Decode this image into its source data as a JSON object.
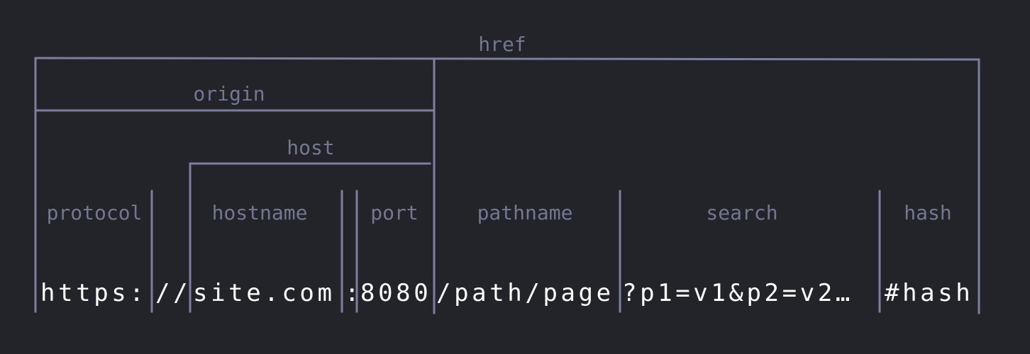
{
  "labels": {
    "href": "href",
    "origin": "origin",
    "host": "host",
    "protocol": "protocol",
    "hostname": "hostname",
    "port": "port",
    "pathname": "pathname",
    "search": "search",
    "hash": "hash"
  },
  "url": {
    "protocol": "https:",
    "slashes": "//",
    "hostname": "site.com",
    "colon": ":",
    "port": "8080",
    "pathname": "/path/page",
    "search": "?p1=v1&p2=v2…",
    "hash": "#hash"
  },
  "colors": {
    "background": "#232429",
    "line": "#7c7f9f",
    "label": "#737792",
    "url_text": "#ffffff"
  }
}
